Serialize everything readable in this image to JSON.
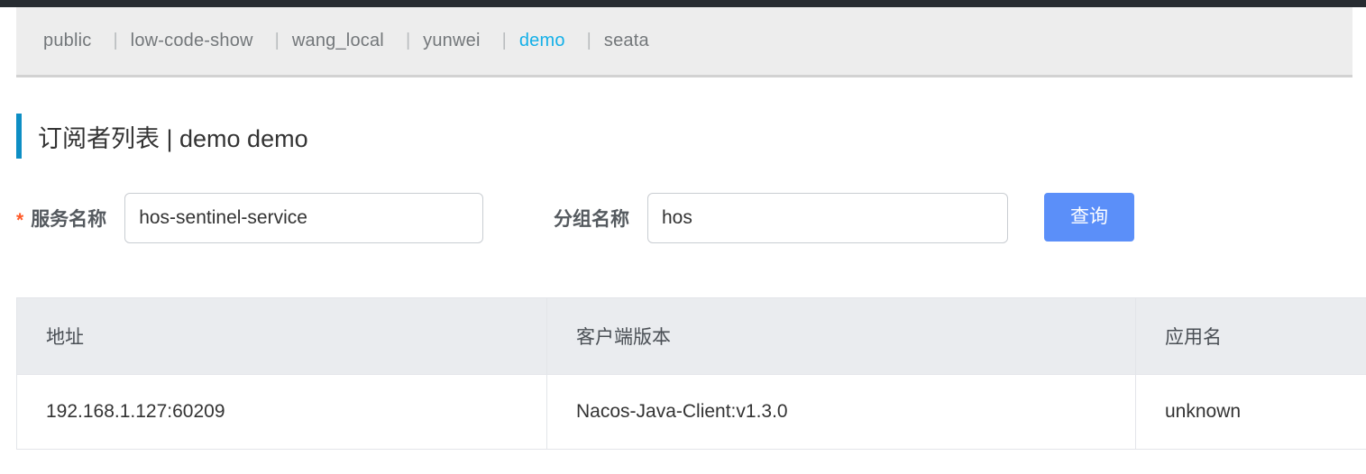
{
  "namespaces": {
    "items": [
      {
        "label": "public",
        "active": false
      },
      {
        "label": "low-code-show",
        "active": false
      },
      {
        "label": "wang_local",
        "active": false
      },
      {
        "label": "yunwei",
        "active": false
      },
      {
        "label": "demo",
        "active": true
      },
      {
        "label": "seata",
        "active": false
      }
    ],
    "separator": "|",
    "active_color": "#14b0e8"
  },
  "header": {
    "title": "订阅者列表  |  demo  demo",
    "accent_color": "#0d8ec4"
  },
  "form": {
    "service": {
      "label": "服务名称",
      "required_mark": "*",
      "value": "hos-sentinel-service",
      "placeholder": "服务名称"
    },
    "group": {
      "label": "分组名称",
      "value": "hos",
      "placeholder": "分组名称"
    },
    "query_button": {
      "label": "查询",
      "color": "#5b8ff9"
    }
  },
  "table": {
    "columns": [
      "地址",
      "客户端版本",
      "应用名"
    ],
    "rows": [
      {
        "address": "192.168.1.127:60209",
        "client_version": "Nacos-Java-Client:v1.3.0",
        "app_name": "unknown"
      }
    ]
  }
}
